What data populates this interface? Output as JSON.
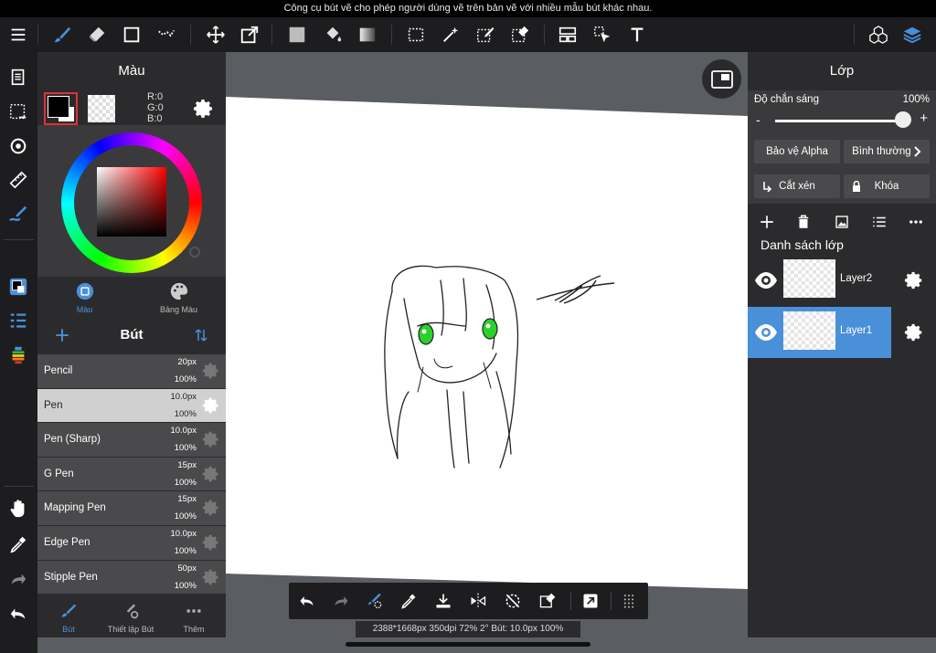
{
  "status_message": "Công cụ bút vẽ cho phép người dùng vẽ trên bản vẽ với nhiều mẫu bút khác nhau.",
  "colors": {
    "accent": "#4a90d9",
    "panel": "#2b2b2d",
    "toolbar": "#1d1d1f",
    "canvas_bg": "#5a5d62"
  },
  "toolbar": {
    "left": [
      "menu-icon",
      "brush-icon",
      "eraser-icon",
      "rectangle-icon",
      "dot-icon"
    ],
    "transform": [
      "move-icon",
      "transform-icon"
    ],
    "fill": [
      "fill-color-icon",
      "bucket-icon",
      "gradient-icon"
    ],
    "select": [
      "selection-icon",
      "magic-wand-icon",
      "select-pen-icon",
      "select-eraser-icon"
    ],
    "edit": [
      "layout-icon",
      "cursor-icon",
      "text-icon"
    ],
    "right": [
      "materials-icon",
      "layers-icon"
    ]
  },
  "color_panel": {
    "title": "Màu",
    "rgb": {
      "r": "R:0",
      "g": "G:0",
      "b": "B:0"
    },
    "foreground": "#000000",
    "background": "#ffffff",
    "tabs": [
      {
        "label": "Màu",
        "active": true
      },
      {
        "label": "Bảng Màu",
        "active": false
      }
    ]
  },
  "brush_panel": {
    "title": "Bút",
    "brushes": [
      {
        "name": "Pencil",
        "size": "20px",
        "opacity": "100%"
      },
      {
        "name": "Pen",
        "size": "10.0px",
        "opacity": "100%",
        "selected": true
      },
      {
        "name": "Pen (Sharp)",
        "size": "10.0px",
        "opacity": "100%"
      },
      {
        "name": "G Pen",
        "size": "15px",
        "opacity": "100%"
      },
      {
        "name": "Mapping Pen",
        "size": "15px",
        "opacity": "100%"
      },
      {
        "name": "Edge Pen",
        "size": "10.0px",
        "opacity": "100%"
      },
      {
        "name": "Stipple Pen",
        "size": "50px",
        "opacity": "100%"
      }
    ],
    "bottom_tabs": [
      {
        "label": "Bút",
        "active": true
      },
      {
        "label": "Thiết lập Bút"
      },
      {
        "label": "Thêm"
      }
    ]
  },
  "info_bar": "2388*1668px 350dpi 72% 2° Bút: 10.0px 100%",
  "layer_panel": {
    "title": "Lớp",
    "opacity_label": "Độ chắn sáng",
    "opacity_value": "100%",
    "opacity_fraction": 1.0,
    "minus": "-",
    "plus": "+",
    "protect_alpha": "Bảo vệ Alpha",
    "blend_mode": "Bình thường",
    "clipping": "Cắt xén",
    "lock": "Khóa",
    "list_title": "Danh sách lớp",
    "layers": [
      {
        "name": "Layer2",
        "selected": false
      },
      {
        "name": "Layer1",
        "selected": true
      }
    ]
  }
}
